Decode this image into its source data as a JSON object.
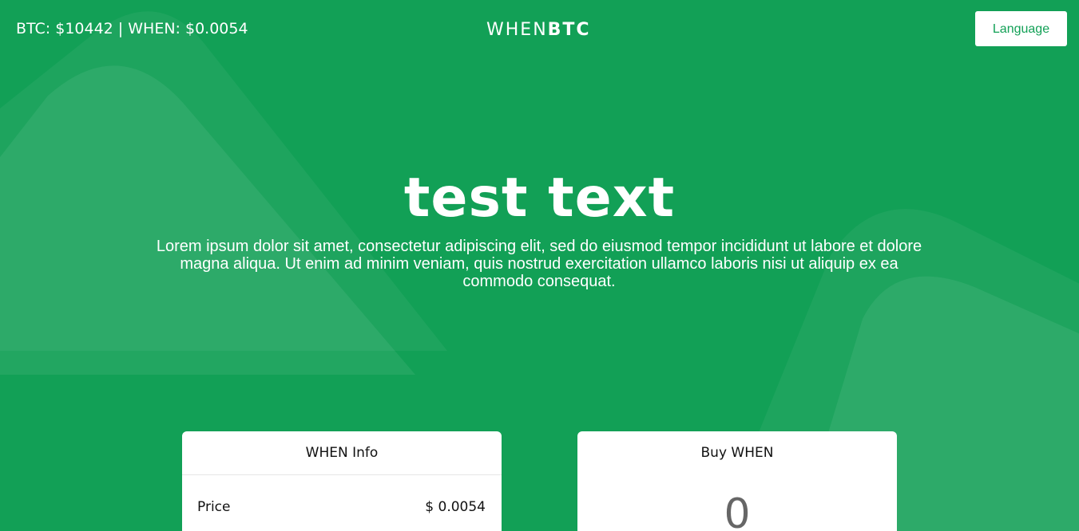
{
  "header": {
    "ticker": "BTC: $10442 | WHEN: $0.0054",
    "logo_light": "WHEN",
    "logo_bold": "BTC",
    "language_label": "Language"
  },
  "hero": {
    "title": "test text",
    "subtitle": "Lorem ipsum dolor sit amet, consectetur adipiscing elit, sed do eiusmod tempor incididunt ut labore et dolore magna aliqua. Ut enim ad minim veniam, quis nostrud exercitation ullamco laboris nisi ut aliquip ex ea commodo consequat."
  },
  "info_card": {
    "title": "WHEN Info",
    "rows": [
      {
        "label": "Price",
        "value": "$ 0.0054"
      }
    ]
  },
  "buy_card": {
    "title": "Buy WHEN",
    "amount": "0"
  },
  "colors": {
    "background": "#12a056",
    "accent": "#12a056",
    "card": "#ffffff"
  }
}
